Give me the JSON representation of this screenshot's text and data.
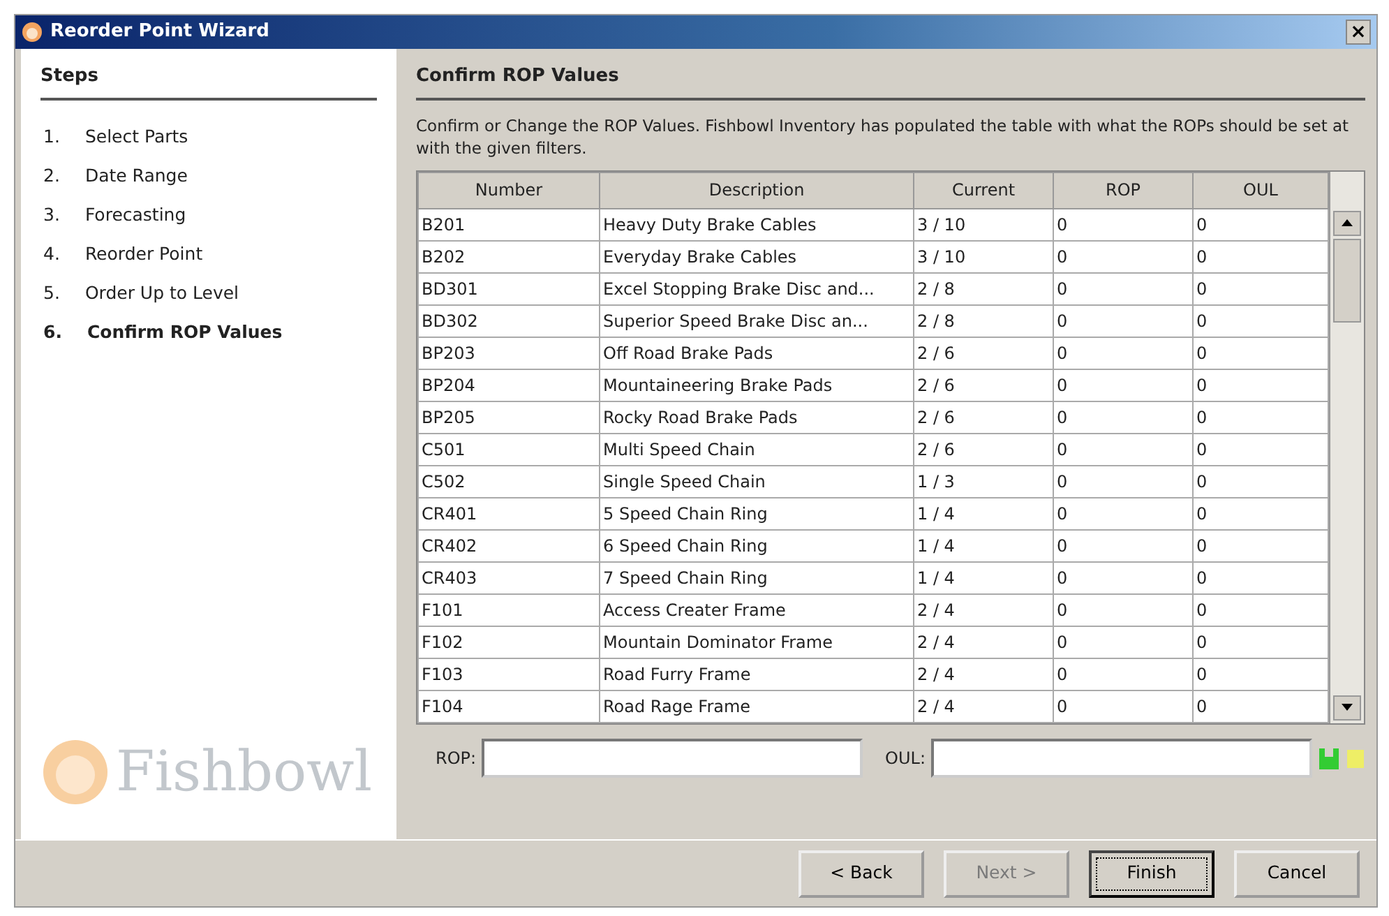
{
  "window": {
    "title": "Reorder Point Wizard",
    "close": "×"
  },
  "sidebar": {
    "title": "Steps",
    "items": [
      {
        "number": "1.",
        "label": "Select Parts",
        "selected": false
      },
      {
        "number": "2.",
        "label": "Date Range",
        "selected": false
      },
      {
        "number": "3.",
        "label": "Forecasting",
        "selected": false
      },
      {
        "number": "4.",
        "label": "Reorder Point",
        "selected": false
      },
      {
        "number": "5.",
        "label": "Order Up to Level",
        "selected": false
      },
      {
        "number": "6.",
        "label": "Confirm ROP Values",
        "selected": true
      }
    ],
    "logo": "Fishbowl"
  },
  "main": {
    "title": "Confirm ROP Values",
    "description": "Confirm or Change the ROP Values. Fishbowl Inventory has populated the table with what the ROPs should be set at with the given filters."
  },
  "table": {
    "columns": [
      "Number",
      "Description",
      "Current",
      "ROP",
      "OUL"
    ],
    "rows": [
      [
        "B201",
        "Heavy Duty Brake Cables",
        "3 / 10",
        "0",
        "0"
      ],
      [
        "B202",
        "Everyday Brake Cables",
        "3 / 10",
        "0",
        "0"
      ],
      [
        "BD301",
        "Excel Stopping Brake Disc and...",
        "2 / 8",
        "0",
        "0"
      ],
      [
        "BD302",
        "Superior Speed Brake Disc an...",
        "2 / 8",
        "0",
        "0"
      ],
      [
        "BP203",
        "Off Road Brake Pads",
        "2 / 6",
        "0",
        "0"
      ],
      [
        "BP204",
        "Mountaineering Brake Pads",
        "2 / 6",
        "0",
        "0"
      ],
      [
        "BP205",
        "Rocky Road Brake Pads",
        "2 / 6",
        "0",
        "0"
      ],
      [
        "C501",
        "Multi Speed Chain",
        "2 / 6",
        "0",
        "0"
      ],
      [
        "C502",
        "Single Speed Chain",
        "1 / 3",
        "0",
        "0"
      ],
      [
        "CR401",
        "5 Speed Chain Ring",
        "1 / 4",
        "0",
        "0"
      ],
      [
        "CR402",
        "6 Speed Chain Ring",
        "1 / 4",
        "0",
        "0"
      ],
      [
        "CR403",
        "7 Speed Chain Ring",
        "1 / 4",
        "0",
        "0"
      ],
      [
        "F101",
        "Access Creater Frame",
        "2 / 4",
        "0",
        "0"
      ],
      [
        "F102",
        "Mountain Dominator Frame",
        "2 / 4",
        "0",
        "0"
      ],
      [
        "F103",
        "Road Furry Frame",
        "2 / 4",
        "0",
        "0"
      ],
      [
        "F104",
        "Road Rage Frame",
        "2 / 4",
        "0",
        "0"
      ]
    ]
  },
  "fields": [
    {
      "label": "ROP:"
    },
    {
      "label": "OUL:"
    }
  ],
  "buttons": [
    {
      "label": "< Back",
      "disabled": false,
      "focused": false
    },
    {
      "label": "Next >",
      "disabled": true,
      "focused": false
    },
    {
      "label": "Finish",
      "disabled": false,
      "focused": true
    },
    {
      "label": "Cancel",
      "disabled": false,
      "focused": false
    }
  ]
}
